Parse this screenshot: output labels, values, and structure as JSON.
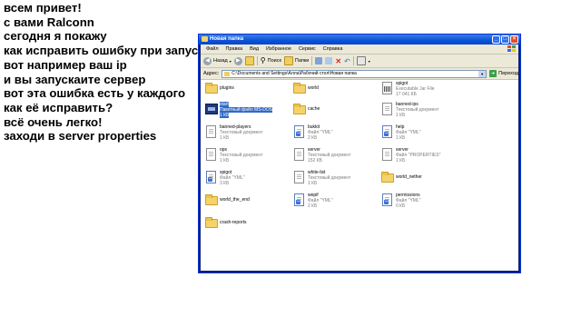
{
  "overlay": {
    "lines": [
      "всем привет!",
      "с вами Ralconn",
      "сегодня я покажу",
      "как исправить ошибку при запуске",
      "вот например ваш ip",
      "и вы запускаите сервер",
      "вот эта ошибка есть у каждого",
      "как её исправить?",
      "всё очень легко!",
      "заходи в server properties"
    ]
  },
  "window": {
    "title": "Новая папка",
    "menu": [
      "Файл",
      "Правка",
      "Вид",
      "Избранное",
      "Сервис",
      "Справка"
    ],
    "toolbar": {
      "back": "Назад",
      "search": "Поиск",
      "folders": "Папки"
    },
    "address": {
      "label": "Адрес:",
      "path": "C:\\Documents and Settings\\Алла\\Рабочий стол\\Новая папка",
      "go": "Переход"
    }
  },
  "items": [
    {
      "name": "plugins",
      "icon": "folder-icon"
    },
    {
      "name": "world",
      "icon": "folder-icon"
    },
    {
      "name": "spigot",
      "type": "Executable Jar File",
      "size": "17 041 КБ",
      "icon": "jar-icon"
    },
    {
      "name": "start",
      "type": "Пакетный файл MS-DOS",
      "size": "1 КБ",
      "icon": "batch-file-icon",
      "selected": true
    },
    {
      "name": "cache",
      "icon": "folder-icon"
    },
    {
      "name": "banned-ips",
      "type": "Текстовый документ",
      "size": "1 КБ",
      "icon": "text-document-icon"
    },
    {
      "name": "banned-players",
      "type": "Текстовый документ",
      "size": "1 КБ",
      "icon": "text-document-icon"
    },
    {
      "name": "bukkit",
      "type": "Файл \"YML\"",
      "size": "2 КБ",
      "icon": "yml-file-icon"
    },
    {
      "name": "help",
      "type": "Файл \"YML\"",
      "size": "1 КБ",
      "icon": "yml-file-icon"
    },
    {
      "name": "ops",
      "type": "Текстовый документ",
      "size": "1 КБ",
      "icon": "text-document-icon"
    },
    {
      "name": "server",
      "type": "Текстовый документ",
      "size": "152 КБ",
      "icon": "text-document-icon"
    },
    {
      "name": "server",
      "type": "Файл \"PROPERTIES\"",
      "size": "1 КБ",
      "icon": "properties-file-icon"
    },
    {
      "name": "spigot",
      "type": "Файл \"YML\"",
      "size": "3 КБ",
      "icon": "yml-file-icon"
    },
    {
      "name": "white-list",
      "type": "Текстовый документ",
      "size": "1 КБ",
      "icon": "text-document-icon"
    },
    {
      "name": "world_nether",
      "icon": "folder-icon"
    },
    {
      "name": "world_the_end",
      "icon": "folder-icon"
    },
    {
      "name": "wepif",
      "type": "Файл \"YML\"",
      "size": "2 КБ",
      "icon": "yml-file-icon"
    },
    {
      "name": "permissions",
      "type": "Файл \"YML\"",
      "size": "0 КБ",
      "icon": "yml-file-icon"
    },
    {
      "name": "crash-reports",
      "icon": "folder-icon"
    }
  ]
}
